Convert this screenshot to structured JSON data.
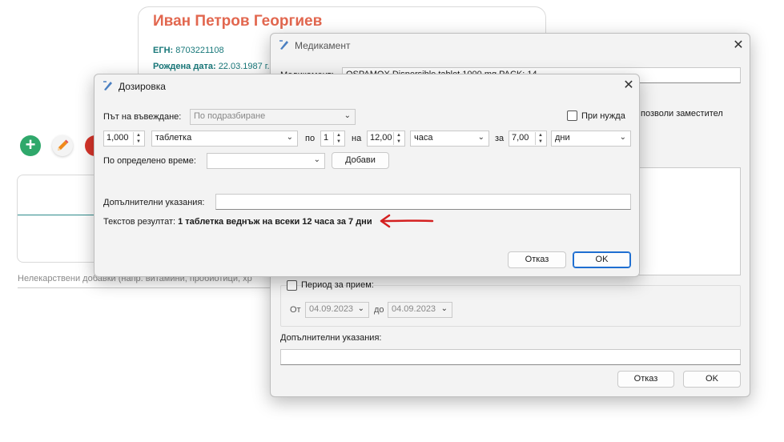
{
  "patient": {
    "name": "Иван Петров Георгиев",
    "egn_label": "ЕГН:",
    "egn_value": "8703221108",
    "dob_label": "Рождена дата:",
    "dob_value": "22.03.1987 г."
  },
  "main": {
    "supplements_placeholder": "Нелекарствени добавки  (напр. витамини, пробиотици, хр"
  },
  "medication_dialog": {
    "title": "Медикамент",
    "medication_label": "Медикамент:",
    "medication_value": "OSPAMOX  Dispersible tablet  1000 mg PACK: 14",
    "allow_substitute_label": "позволи заместител",
    "period_label": "Период за прием:",
    "from_label": "От",
    "from_value": "04.09.2023",
    "to_label": "до",
    "to_value": "04.09.2023",
    "extra_instructions_label": "Допълнителни указания:",
    "extra_instructions_value": "",
    "cancel_label": "Отказ",
    "ok_label": "OK"
  },
  "dosage_dialog": {
    "title": "Дозировка",
    "route_label": "Път на въвеждане:",
    "route_value": "По подразбиране",
    "as_needed_label": "При нужда",
    "quantity": "1,000",
    "unit": "таблетка",
    "per_label": "по",
    "times": "1",
    "on_label": "на",
    "interval": "12,00",
    "interval_unit": "часа",
    "for_label": "за",
    "duration": "7,00",
    "duration_unit": "дни",
    "fixed_time_label": "По определено време:",
    "fixed_time_value": "",
    "add_label": "Добави",
    "extra_instructions_label": "Допълнителни указания:",
    "extra_instructions_value": "",
    "result_label": "Текстов резултат:",
    "result_value": "1 таблетка веднъж на всеки 12 часа за 7 дни",
    "cancel_label": "Отказ",
    "ok_label": "OK"
  },
  "colors": {
    "patient_name": "#e2674f",
    "info_text": "#18787a",
    "annotation_arrow": "#d42020",
    "primary_button_border": "#1f6fd1"
  }
}
